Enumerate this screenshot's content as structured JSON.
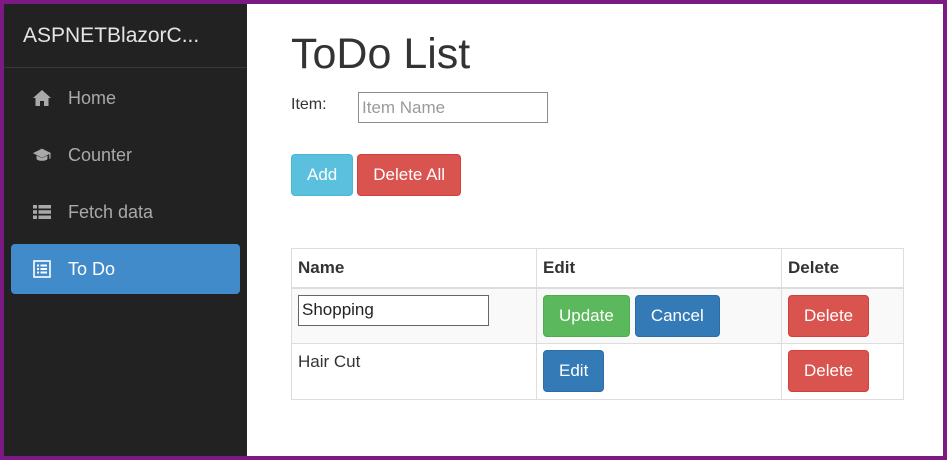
{
  "sidebar": {
    "brand": "ASPNETBlazorC...",
    "items": [
      {
        "label": "Home",
        "icon": "home-icon"
      },
      {
        "label": "Counter",
        "icon": "graduation-cap-icon"
      },
      {
        "label": "Fetch data",
        "icon": "list-icon"
      },
      {
        "label": "To Do",
        "icon": "list-alt-icon",
        "active": true
      }
    ]
  },
  "main": {
    "title": "ToDo List",
    "item_label": "Item:",
    "item_placeholder": "Item Name",
    "add_label": "Add",
    "delete_all_label": "Delete All"
  },
  "table": {
    "headers": [
      "Name",
      "Edit",
      "Delete"
    ],
    "rows": [
      {
        "name": "Shopping",
        "editing": true,
        "update_label": "Update",
        "cancel_label": "Cancel",
        "delete_label": "Delete"
      },
      {
        "name": "Hair Cut",
        "editing": false,
        "edit_label": "Edit",
        "delete_label": "Delete"
      }
    ]
  },
  "colors": {
    "sidebar_bg": "#222222",
    "active_nav": "#428bca",
    "info": "#5bc0de",
    "danger": "#d9534f",
    "success": "#5cb85c",
    "primary": "#337ab7",
    "window_border": "#7a1a82"
  }
}
